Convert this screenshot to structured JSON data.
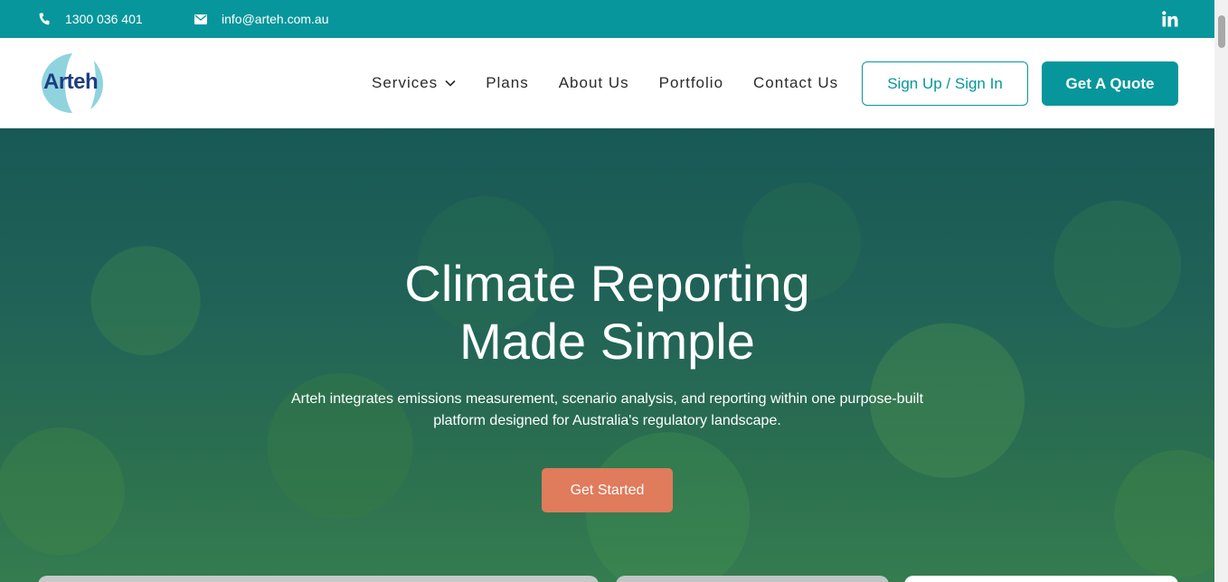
{
  "topbar": {
    "phone": "1300 036 401",
    "email": "info@arteh.com.au",
    "social_icon": "linkedin-icon",
    "bg_color": "#07969b"
  },
  "header": {
    "logo_text": "Arteh",
    "nav": [
      {
        "label": "Services",
        "has_dropdown": true
      },
      {
        "label": "Plans"
      },
      {
        "label": "About Us"
      },
      {
        "label": "Portfolio"
      },
      {
        "label": "Contact Us"
      }
    ],
    "signin_label": "Sign Up / Sign In",
    "quote_label": "Get A Quote"
  },
  "hero": {
    "title_line1": "Climate Reporting",
    "title_line2": "Made Simple",
    "subtitle_line1": "Arteh integrates emissions measurement, scenario analysis, and reporting within one purpose-built",
    "subtitle_line2": "platform designed for Australia's regulatory landscape.",
    "cta_label": "Get Started",
    "cta_color": "#e07b5c"
  },
  "colors": {
    "accent": "#07969b",
    "logo_blue": "#1d3d82",
    "logo_light": "#8fd3df"
  }
}
